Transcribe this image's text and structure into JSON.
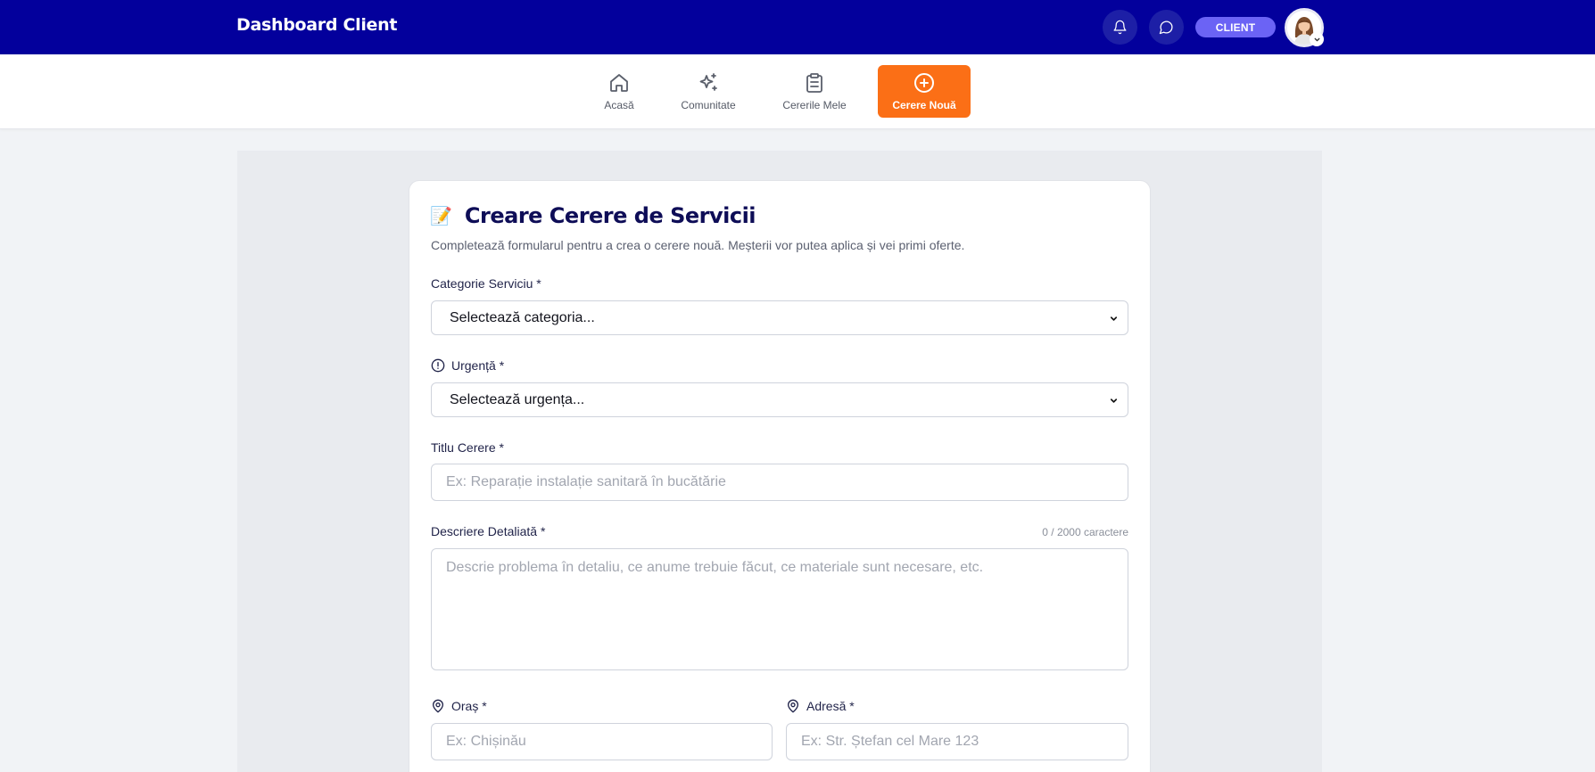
{
  "header": {
    "brand": "Dashboard Client",
    "role_badge": "CLIENT",
    "icons": [
      "bell-icon",
      "chat-icon"
    ],
    "colors": {
      "bar": "#03009c",
      "badge": "#6b63f5"
    }
  },
  "nav": {
    "items": [
      {
        "label": "Acasă",
        "icon": "home-icon"
      },
      {
        "label": "Comunitate",
        "icon": "sparkles-icon"
      },
      {
        "label": "Cererile Mele",
        "icon": "clipboard-icon"
      },
      {
        "label": "Cerere Nouă",
        "icon": "plus-circle-icon",
        "active": true
      }
    ],
    "active_color": "#fb6f16"
  },
  "form": {
    "emoji": "📝",
    "title": "Creare Cerere de Servicii",
    "subtitle": "Completează formularul pentru a crea o cerere nouă. Meșterii vor putea aplica și vei primi oferte.",
    "category": {
      "label": "Categorie Serviciu *",
      "selected": "Selectează categoria..."
    },
    "urgency": {
      "label": "Urgență *",
      "selected": "Selectează urgența..."
    },
    "title_field": {
      "label": "Titlu Cerere *",
      "placeholder": "Ex: Reparație instalație sanitară în bucătărie"
    },
    "description": {
      "label": "Descriere Detaliată *",
      "counter": "0 / 2000 caractere",
      "placeholder": "Descrie problema în detaliu, ce anume trebuie făcut, ce materiale sunt necesare, etc."
    },
    "city": {
      "label": "Oraș *",
      "placeholder": "Ex: Chișinău"
    },
    "address": {
      "label": "Adresă *",
      "placeholder": "Ex: Str. Ștefan cel Mare 123"
    }
  }
}
